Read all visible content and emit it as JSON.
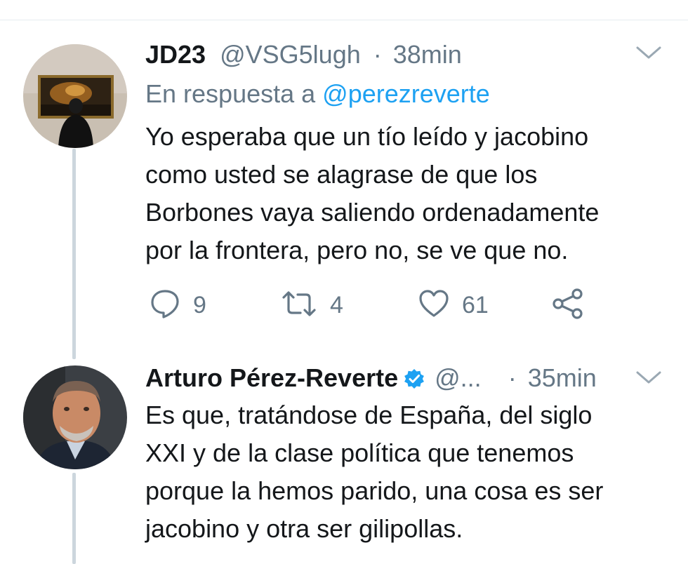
{
  "tweets": [
    {
      "name": "JD23",
      "handle": "@VSG5lugh",
      "separator": "·",
      "time": "38min",
      "reply_prefix": "En respuesta a",
      "reply_to": "@perezreverte",
      "text_lines": [
        "Yo esperaba que un tío leído y jacobino",
        "como usted se alagrase de que los",
        "Borbones vaya saliendo ordenadamente",
        "por la frontera, pero no, se ve que no."
      ],
      "actions": {
        "replies": "9",
        "retweets": "4",
        "likes": "61"
      }
    },
    {
      "name": "Arturo Pérez-Reverte",
      "handle": "@...",
      "separator": "·",
      "time": "35min",
      "verified": true,
      "text_lines": [
        "Es que, tratándose de España, del siglo",
        "XXI y de la clase política que tenemos",
        "porque la hemos parido, una cosa es ser",
        "jacobino y otra ser gilipollas."
      ]
    }
  ],
  "icons": {
    "reply": "reply-icon",
    "retweet": "retweet-icon",
    "like": "heart-icon",
    "share": "share-icon",
    "menu": "chevron-down-icon",
    "verified": "verified-badge-icon"
  },
  "colors": {
    "link": "#1da1f2",
    "secondary_text": "#657786",
    "thread_line": "#ccd6dd"
  }
}
